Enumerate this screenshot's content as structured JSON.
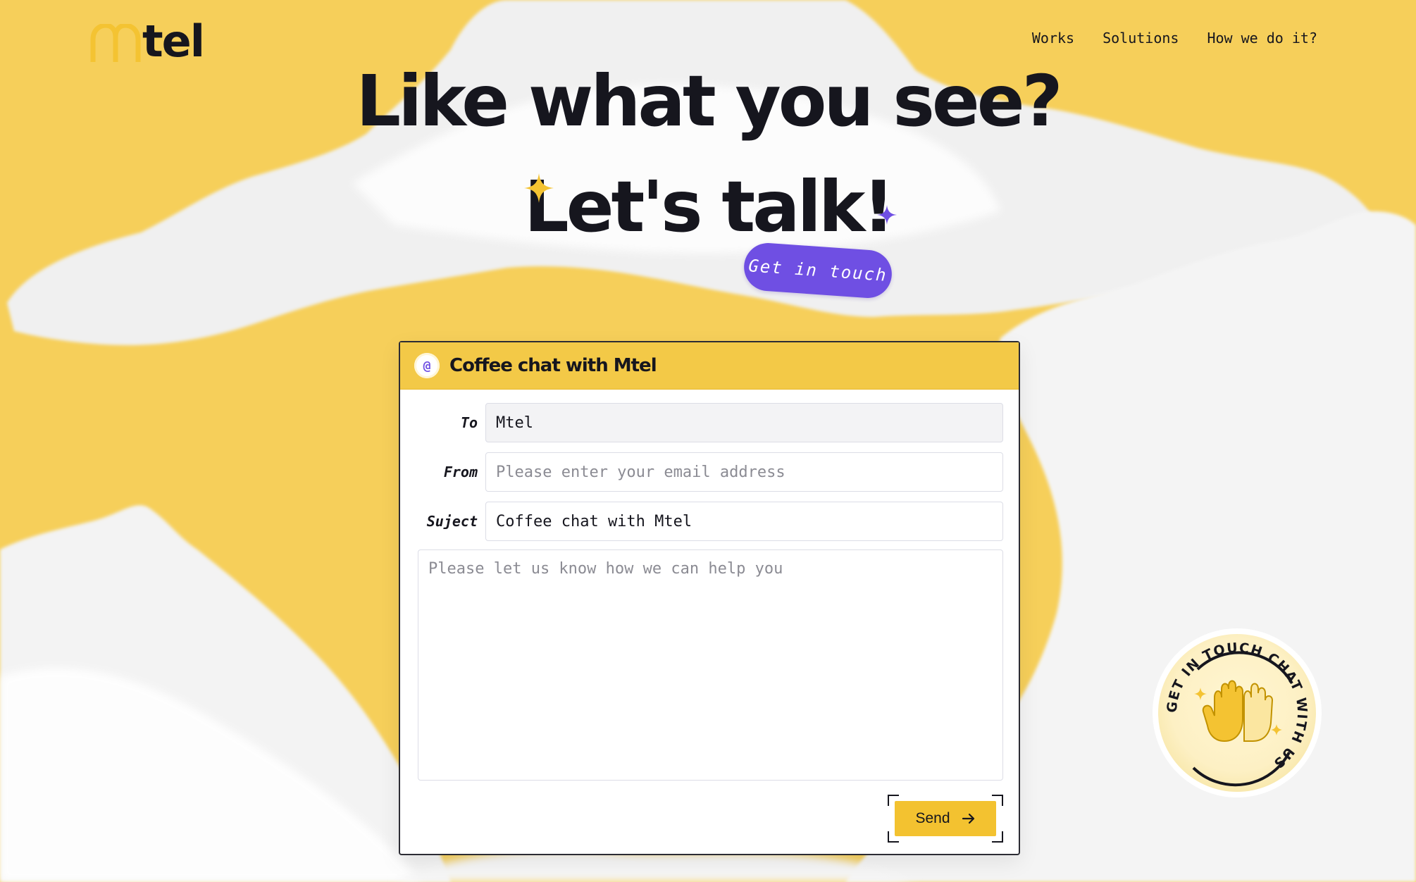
{
  "brand": {
    "logo_text": "tel",
    "logo_color": "#f4c332"
  },
  "nav": {
    "items": [
      {
        "label": "Works"
      },
      {
        "label": "Solutions"
      },
      {
        "label": "How we do it?"
      }
    ]
  },
  "hero": {
    "line1": "Like what you see?",
    "line2": "Let's talk!",
    "cta_label": "Get in touch"
  },
  "form": {
    "title": "Coffee chat with Mtel",
    "badge_icon": "at-sign-icon",
    "to": {
      "label": "To",
      "value": "Mtel"
    },
    "from": {
      "label": "From",
      "placeholder": "Please enter your email address"
    },
    "subject": {
      "label": "Suject",
      "value": "Coffee chat with Mtel"
    },
    "message": {
      "placeholder": "Please let us know how we can help you"
    },
    "send_label": "Send",
    "send_icon": "arrow-right-icon"
  },
  "chat_badge": {
    "text": "GET IN TOUCH CHAT WITH US",
    "icon": "high-five-hands-icon"
  },
  "colors": {
    "background": "#f6cf5a",
    "accent": "#f3c230",
    "purple": "#6f4fe3",
    "ink": "#16161e"
  }
}
